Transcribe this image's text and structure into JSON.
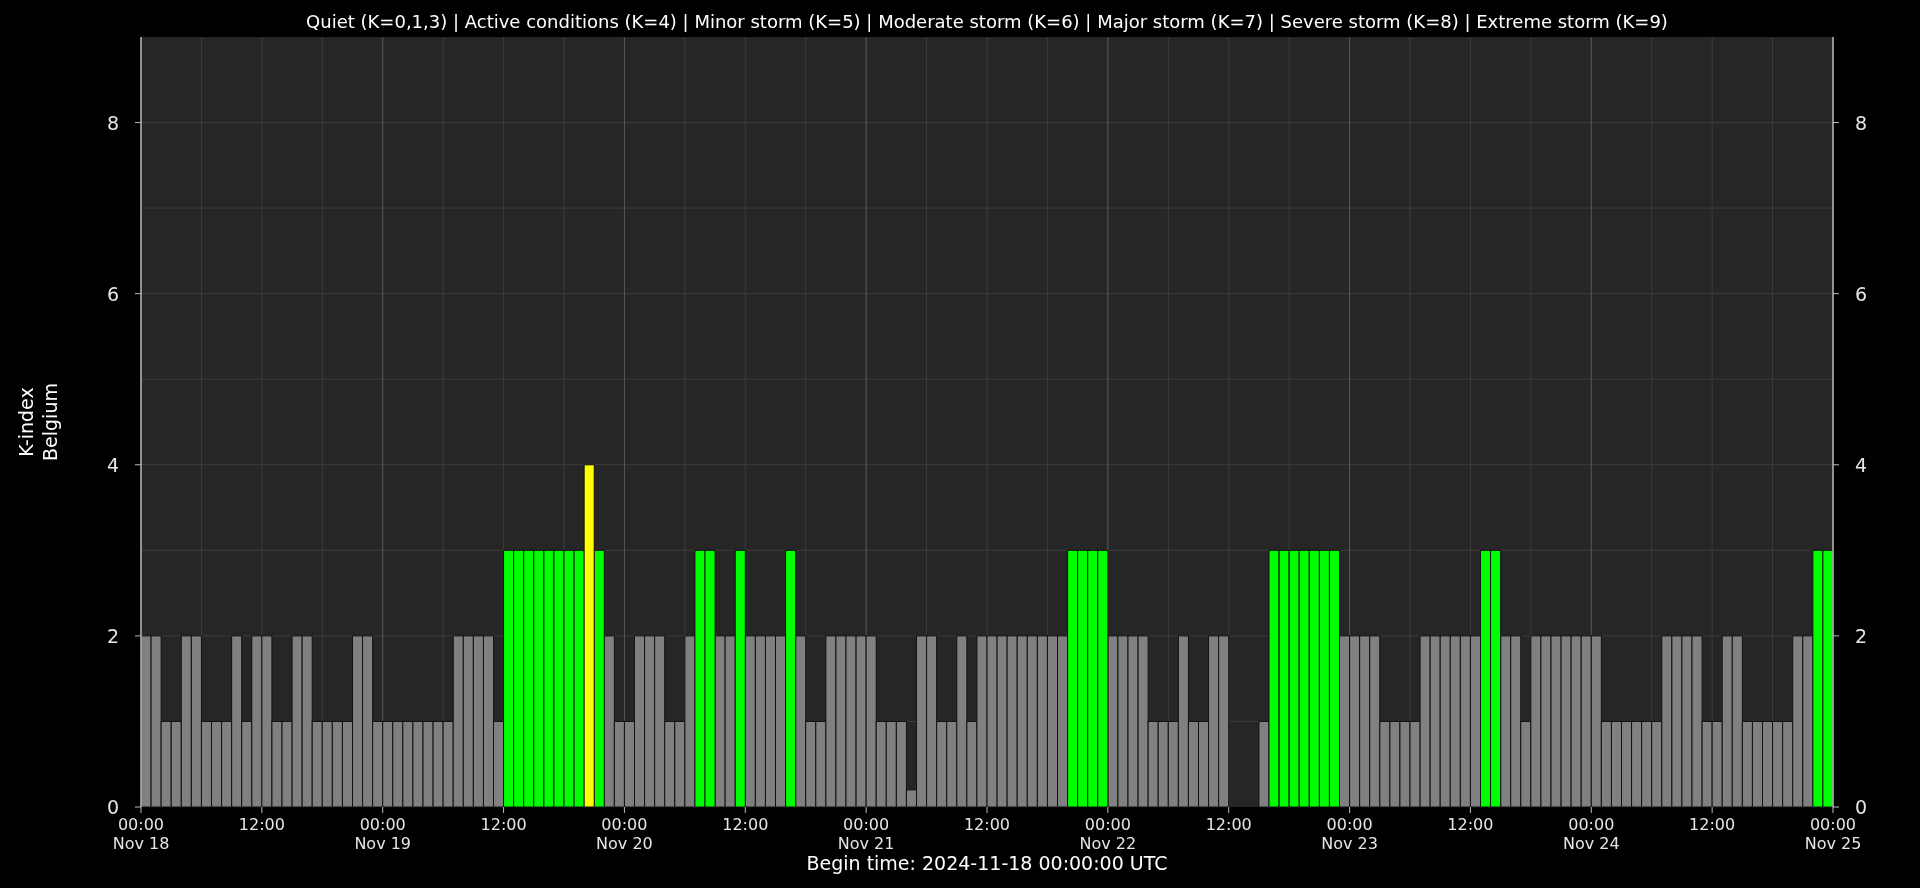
{
  "chart_data": {
    "type": "bar",
    "title": "Quiet (K=0,1,3) | Active conditions (K=4) | Minor storm (K=5) | Moderate storm (K=6) | Major storm (K=7) | Severe storm (K=8) | Extreme storm (K=9)",
    "xlabel": "Begin time: 2024-11-18 00:00:00 UTC",
    "ylabel": "K-index\nBelgium",
    "grid": true,
    "ylim": [
      0,
      9
    ],
    "yticks": [
      0,
      2,
      4,
      6,
      8
    ],
    "y2lim": [
      0,
      9
    ],
    "y2ticks": [
      0,
      2,
      4,
      6,
      8
    ],
    "categories": [
      "00:00\nNov 18",
      null,
      null,
      null,
      null,
      null,
      null,
      null,
      null,
      null,
      null,
      null,
      "12:00",
      null,
      null,
      null,
      null,
      null,
      null,
      null,
      null,
      null,
      null,
      null,
      "00:00\nNov 19",
      null,
      null,
      null,
      null,
      null,
      null,
      null,
      null,
      null,
      null,
      null,
      "12:00",
      null,
      null,
      null,
      null,
      null,
      null,
      null,
      null,
      null,
      null,
      null,
      "00:00\nNov 20",
      null,
      null,
      null,
      null,
      null,
      null,
      null,
      null,
      null,
      null,
      null,
      "12:00",
      null,
      null,
      null,
      null,
      null,
      null,
      null,
      null,
      null,
      null,
      null,
      "00:00\nNov 21",
      null,
      null,
      null,
      null,
      null,
      null,
      null,
      null,
      null,
      null,
      null,
      "12:00",
      null,
      null,
      null,
      null,
      null,
      null,
      null,
      null,
      null,
      null,
      null,
      "00:00\nNov 22",
      null,
      null,
      null,
      null,
      null,
      null,
      null,
      null,
      null,
      null,
      null,
      "12:00",
      null,
      null,
      null,
      null,
      null,
      null,
      null,
      null,
      null,
      null,
      null,
      "00:00\nNov 23",
      null,
      null,
      null,
      null,
      null,
      null,
      null,
      null,
      null,
      null,
      null,
      "12:00",
      null,
      null,
      null,
      null,
      null,
      null,
      null,
      null,
      null,
      null,
      null,
      "00:00\nNov 24",
      null,
      null,
      null,
      null,
      null,
      null,
      null,
      null,
      null,
      null,
      null,
      "12:00",
      null,
      null,
      null,
      null,
      null,
      null,
      null,
      null,
      null,
      null,
      null,
      "00:00\nNov 25"
    ],
    "series": [
      {
        "color": "#808080",
        "values": [
          2,
          2,
          1,
          1,
          2,
          2,
          1,
          1,
          1,
          2,
          1,
          2,
          2,
          1,
          1,
          2,
          2,
          1,
          1,
          1,
          1,
          2,
          2,
          1,
          1,
          1,
          1,
          1,
          1,
          1,
          1,
          2,
          2,
          2,
          2,
          1,
          null,
          null,
          null,
          null,
          null,
          null,
          null,
          null,
          null,
          null,
          2,
          1,
          1,
          2,
          2,
          2,
          1,
          1,
          2,
          null,
          null,
          2,
          2,
          null,
          2,
          2,
          2,
          2,
          null,
          2,
          1,
          1,
          2,
          2,
          2,
          2,
          2,
          1,
          1,
          1,
          0.2,
          2,
          2,
          1,
          1,
          2,
          1,
          2,
          2,
          2,
          2,
          2,
          2,
          2,
          2,
          2,
          null,
          null,
          null,
          null,
          2,
          2,
          2,
          2,
          1,
          1,
          1,
          2,
          1,
          1,
          2,
          2,
          0,
          0,
          0,
          1,
          null,
          null,
          null,
          null,
          null,
          null,
          null,
          2,
          2,
          2,
          2,
          1,
          1,
          1,
          1,
          2,
          2,
          2,
          2,
          2,
          2,
          null,
          null,
          2,
          2,
          1,
          2,
          2,
          2,
          2,
          2,
          2,
          2,
          1,
          1,
          1,
          1,
          1,
          1,
          2,
          2,
          2,
          2,
          1,
          1,
          2,
          2,
          1,
          1,
          1,
          1,
          1,
          2,
          2,
          null,
          null,
          null
        ]
      },
      {
        "color": "#00ff00",
        "values": [
          null,
          null,
          null,
          null,
          null,
          null,
          null,
          null,
          null,
          null,
          null,
          null,
          null,
          null,
          null,
          null,
          null,
          null,
          null,
          null,
          null,
          null,
          null,
          null,
          null,
          null,
          null,
          null,
          null,
          null,
          null,
          null,
          null,
          null,
          null,
          null,
          3,
          3,
          3,
          3,
          3,
          3,
          3,
          3,
          null,
          3,
          null,
          null,
          null,
          null,
          null,
          null,
          null,
          null,
          null,
          3,
          3,
          null,
          null,
          3,
          null,
          null,
          null,
          null,
          3,
          null,
          null,
          null,
          null,
          null,
          null,
          null,
          null,
          null,
          null,
          null,
          null,
          null,
          null,
          null,
          null,
          null,
          null,
          null,
          null,
          null,
          null,
          null,
          null,
          null,
          null,
          null,
          3,
          3,
          3,
          3,
          null,
          null,
          null,
          null,
          null,
          null,
          null,
          null,
          null,
          null,
          null,
          null,
          null,
          null,
          null,
          null,
          3,
          3,
          3,
          3,
          3,
          3,
          3,
          null,
          null,
          null,
          null,
          null,
          null,
          null,
          null,
          null,
          null,
          null,
          null,
          null,
          null,
          3,
          3,
          null,
          null,
          null,
          null,
          null,
          null,
          null,
          null,
          null,
          null,
          null,
          null,
          null,
          null,
          null,
          null,
          null,
          null,
          null,
          null,
          null,
          null,
          null,
          null,
          null,
          null,
          null,
          null,
          null,
          null,
          null,
          3,
          3,
          null
        ]
      },
      {
        "color": "#ffff00",
        "values": [
          null,
          null,
          null,
          null,
          null,
          null,
          null,
          null,
          null,
          null,
          null,
          null,
          null,
          null,
          null,
          null,
          null,
          null,
          null,
          null,
          null,
          null,
          null,
          null,
          null,
          null,
          null,
          null,
          null,
          null,
          null,
          null,
          null,
          null,
          null,
          null,
          null,
          null,
          null,
          null,
          null,
          null,
          null,
          null,
          4,
          null,
          null,
          null,
          null,
          null,
          null,
          null,
          null,
          null,
          null,
          null,
          null,
          null,
          null,
          null,
          null,
          null,
          null,
          null,
          null,
          null,
          null,
          null,
          null,
          null,
          null,
          null,
          null,
          null,
          null,
          null,
          null,
          null,
          null,
          null,
          null,
          null,
          null,
          null,
          null,
          null,
          null,
          null,
          null,
          null,
          null,
          null,
          null,
          null,
          null,
          null,
          null,
          null,
          null,
          null,
          null,
          null,
          null,
          null,
          null,
          null,
          null,
          null,
          null,
          null,
          null,
          null,
          null,
          null,
          null,
          null,
          null,
          null,
          null,
          null,
          null,
          null,
          null,
          null,
          null,
          null,
          null,
          null,
          null,
          null,
          null,
          null,
          null,
          null,
          null,
          null,
          null,
          null,
          null,
          null,
          null,
          null,
          null,
          null,
          null,
          null,
          null,
          null,
          null,
          null,
          null,
          null,
          null,
          null,
          null,
          null,
          null,
          null,
          null,
          null,
          null,
          null,
          null,
          null,
          null,
          null,
          null,
          null,
          null
        ]
      }
    ]
  }
}
